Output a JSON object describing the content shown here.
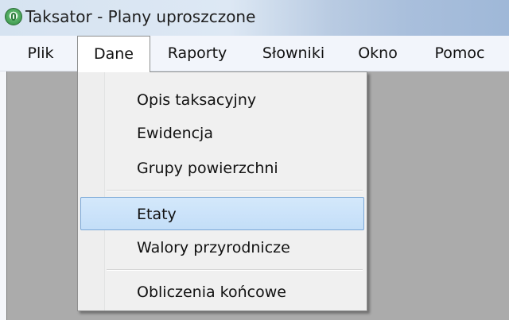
{
  "window": {
    "title": "Taksator - Plany uproszczone",
    "icon": "app-logo-icon"
  },
  "menubar": {
    "items": [
      {
        "label": "Plik"
      },
      {
        "label": "Dane"
      },
      {
        "label": "Raporty"
      },
      {
        "label": "Słowniki"
      },
      {
        "label": "Okno"
      },
      {
        "label": "Pomoc"
      }
    ],
    "active": "Dane"
  },
  "dropdown": {
    "items": [
      {
        "label": "Opis taksacyjny"
      },
      {
        "label": "Ewidencja"
      },
      {
        "label": "Grupy powierzchni"
      },
      {
        "label": "Etaty"
      },
      {
        "label": "Walory przyrodnicze"
      },
      {
        "label": "Obliczenia końcowe"
      }
    ],
    "highlighted": "Etaty"
  }
}
